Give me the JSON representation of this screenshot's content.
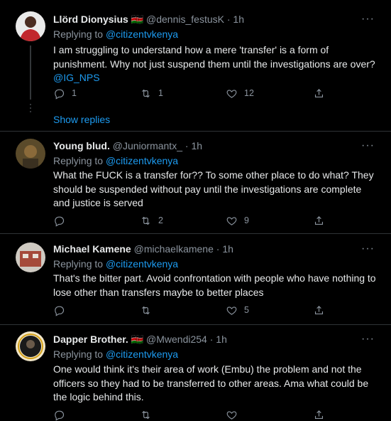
{
  "tweets": [
    {
      "name": "Llörd Dionysius",
      "flag": "🇰🇪",
      "handle": "@dennis_festusK",
      "time": "· 1h",
      "replying_prefix": "Replying to",
      "replying_to": "@citizentvkenya",
      "text": "I am struggling to understand how a mere 'transfer' is a form of punishment. Why not just suspend them until the investigations are over?",
      "link": "@IG_NPS",
      "reply_count": "1",
      "retweet_count": "1",
      "like_count": "12",
      "show_replies": "Show replies"
    },
    {
      "name": "Young blud.",
      "handle": "@Juniormantx_",
      "time": "· 1h",
      "replying_prefix": "Replying to",
      "replying_to": "@citizentvkenya",
      "text": "What the FUCK is a transfer for?? To some other place to do what? They should be suspended without pay until the investigations are complete and justice is served",
      "reply_count": "",
      "retweet_count": "2",
      "like_count": "9"
    },
    {
      "name": "Michael Kamene",
      "handle": "@michaelkamene",
      "time": "· 1h",
      "replying_prefix": "Replying to",
      "replying_to": "@citizentvkenya",
      "text": "That's the bitter part. Avoid confrontation with people who have nothing to lose other than transfers maybe to better places",
      "reply_count": "",
      "retweet_count": "",
      "like_count": "5"
    },
    {
      "name": "Dapper Brother.",
      "name_badge": "🇰🇪",
      "handle": "@Mwendi254",
      "time": "· 1h",
      "replying_prefix": "Replying to",
      "replying_to": "@citizentvkenya",
      "text": "One would think it's their area of work (Embu) the problem and not the officers so they had to be transferred to other areas. Ama what could be the logic behind this.",
      "reply_count": "",
      "retweet_count": "",
      "like_count": ""
    }
  ],
  "colors": {
    "background": "#000000",
    "text": "#e7e9ea",
    "muted": "#8b949e",
    "accent": "#1d9bf0",
    "divider": "#2f3336"
  },
  "icons": [
    "reply-icon",
    "retweet-icon",
    "like-icon",
    "share-icon",
    "more-icon"
  ]
}
